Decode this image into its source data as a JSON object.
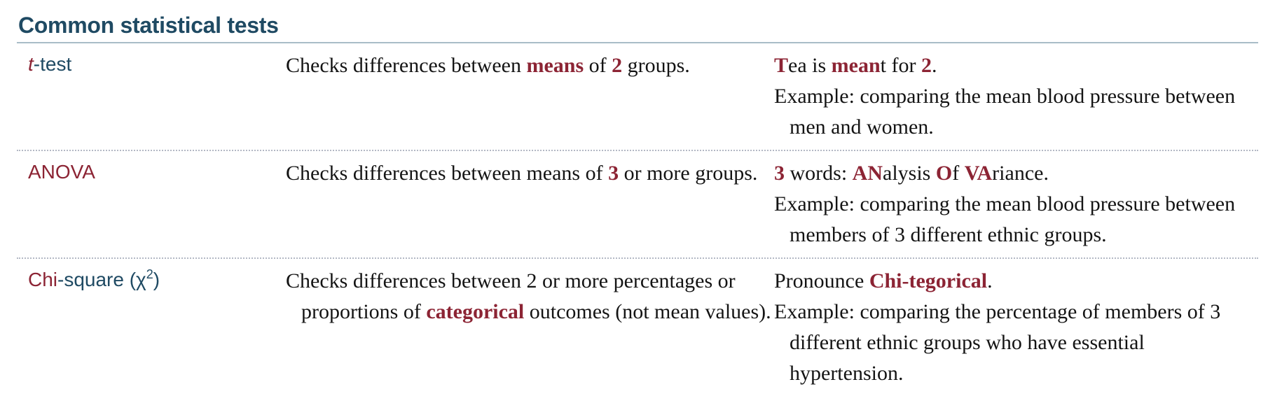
{
  "title": "Common statistical tests",
  "rows": [
    {
      "name": {
        "italic": "t",
        "rest": "-test"
      },
      "desc": {
        "p1": "Checks differences between ",
        "hl1": "means",
        "p2": " of ",
        "hl2": "2",
        "p3": " groups."
      },
      "mnemonic": {
        "hl1": "T",
        "p1": "ea is ",
        "hl2": "mean",
        "p2": "t for ",
        "hl3": "2",
        "p3": "."
      },
      "example": "Example: comparing the mean blood pressure between men and women."
    },
    {
      "name": {
        "text": "ANOVA"
      },
      "desc": {
        "p1": "Checks differences between means of ",
        "hl1": "3",
        "p2": " or more groups."
      },
      "mnemonic": {
        "hl1": "3",
        "p1": " words: ",
        "hl2": "AN",
        "p2": "alysis ",
        "hl3": "O",
        "p3": "f ",
        "hl4": "VA",
        "p4": "riance."
      },
      "example": "Example: comparing the mean blood pressure between members of 3 different ethnic groups."
    },
    {
      "name": {
        "red": "Chi",
        "rest": "-square (χ",
        "sup": "2",
        "close": ")"
      },
      "desc": {
        "p1": "Checks differences between 2 or more percentages or proportions of ",
        "hl1": "categorical",
        "p2": " outcomes (not mean values)."
      },
      "mnemonic": {
        "p1": "Pronounce ",
        "hl1": "Chi-tegorical",
        "p2": "."
      },
      "example": "Example: comparing the percentage of members of 3 different ethnic groups who have essential hypertension."
    }
  ]
}
